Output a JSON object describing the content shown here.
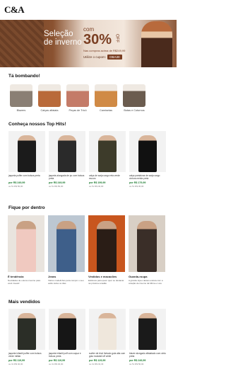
{
  "header": {
    "logo": "C&A"
  },
  "hero": {
    "title": "Seleção de inverno",
    "offer_prefix": "com",
    "offer_value": "30%",
    "offer_suffix": "OFF",
    "note": "Nas compras acima de R$249,99",
    "coupon_label": "Utilize o cupom:",
    "coupon_code": "OBA30",
    "colors": {
      "brown": "#7a3e22",
      "cream": "#f3e7dc"
    }
  },
  "trending": {
    "title": "Tá bombando!",
    "items": [
      {
        "label": "Blazers",
        "color": "#8a7f74"
      },
      {
        "label": "Calças alfaiata",
        "color": "#b96a3a"
      },
      {
        "label": "Peças de Tricô",
        "color": "#c47b68"
      },
      {
        "label": "Camisetas",
        "color": "#d08a45"
      },
      {
        "label": "Botas e Coturnos",
        "color": "#6b5c4f"
      }
    ]
  },
  "top_hits": {
    "title": "Conheça nossos Top Hits!",
    "items": [
      {
        "name": "jaqueta puffer com bolsos preta",
        "price": "por R$ 249,99",
        "installments": "ou 5x R$ 50,00"
      },
      {
        "name": "jaqueta alongada de pu com bolsos preta",
        "price": "por R$ 249,99",
        "installments": "ou 5x R$ 50,00"
      },
      {
        "name": "calça de sarja cargo reta verde escuro",
        "price": "por R$ 199,99",
        "installments": "ou 5x R$ 40,00"
      },
      {
        "name": "calça pantalona de sarja cargo cintura média preta",
        "price": "por R$ 179,99",
        "installments": "ou 5x R$ 36,00"
      }
    ]
  },
  "inside": {
    "title": "Fique por dentro",
    "items": [
      {
        "title": "É tendência",
        "desc": "Novidades de outono-inverno para você investir"
      },
      {
        "title": "Jeans",
        "desc": "Vários modelinhos para compor o seu estilo todos os dias"
      },
      {
        "title": "Vestidos e macacões",
        "desc": "Estilosos para quem quer se destacar na próxima ocasião"
      },
      {
        "title": "Guarda-roupa",
        "desc": "A grande loja é destes estreia com a coleção de inverno da Mirna e Lore"
      }
    ]
  },
  "more_sold": {
    "title": "Mais vendidos",
    "items": [
      {
        "name": "jaqueta infantil puffer com bolsos verde militar",
        "price": "por R$ 119,99",
        "installments": "ou 3x R$ 40,00"
      },
      {
        "name": "jaqueta infantil puff com capuz e bolsos preta",
        "price": "por R$ 119,99",
        "installments": "ou 3x R$ 40,00"
      },
      {
        "name": "suéter de tricô listrado gola alta com gola modalsil off white",
        "price": "por R$ 129,99",
        "installments": "ou 3x R$ 43,33"
      },
      {
        "name": "blazer alongado alfaiatado com cinto preta",
        "price": "por R$ 249,99",
        "installments": "ou 5x R$ 50,00"
      }
    ]
  }
}
